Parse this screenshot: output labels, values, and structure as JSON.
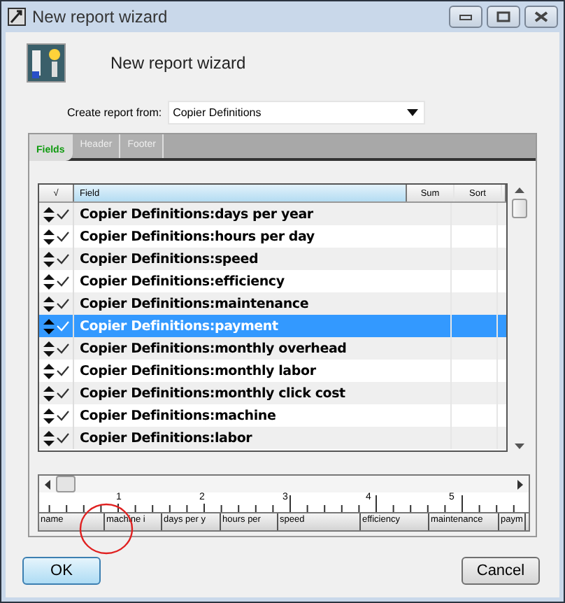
{
  "window": {
    "title": "New report wizard"
  },
  "header": {
    "title": "New report wizard"
  },
  "source": {
    "label": "Create report from:",
    "value": "Copier Definitions"
  },
  "tabs": [
    {
      "label": "Fields",
      "selected": true
    },
    {
      "label": "Header",
      "selected": false
    },
    {
      "label": "Footer",
      "selected": false
    }
  ],
  "table": {
    "columns": [
      "√",
      "Field",
      "Sum",
      "Sort"
    ],
    "rows": [
      {
        "field": "Copier Definitions:days per year",
        "checked": true,
        "selected": false
      },
      {
        "field": "Copier Definitions:hours per day",
        "checked": true,
        "selected": false
      },
      {
        "field": "Copier Definitions:speed",
        "checked": true,
        "selected": false
      },
      {
        "field": "Copier Definitions:efficiency",
        "checked": true,
        "selected": false
      },
      {
        "field": "Copier Definitions:maintenance",
        "checked": true,
        "selected": false
      },
      {
        "field": "Copier Definitions:payment",
        "checked": true,
        "selected": true
      },
      {
        "field": "Copier Definitions:monthly overhead",
        "checked": true,
        "selected": false
      },
      {
        "field": "Copier Definitions:monthly labor",
        "checked": true,
        "selected": false
      },
      {
        "field": "Copier Definitions:monthly click cost",
        "checked": true,
        "selected": false
      },
      {
        "field": "Copier Definitions:machine",
        "checked": true,
        "selected": false
      },
      {
        "field": "Copier Definitions:labor",
        "checked": true,
        "selected": false
      }
    ]
  },
  "ruler": {
    "numbers": [
      "1",
      "2",
      "3",
      "4",
      "5"
    ],
    "columns": [
      "name",
      "machine i",
      "days per y",
      "hours per",
      "speed",
      "efficiency",
      "maintenance",
      "paym"
    ]
  },
  "buttons": [
    "OK",
    "Cancel"
  ]
}
